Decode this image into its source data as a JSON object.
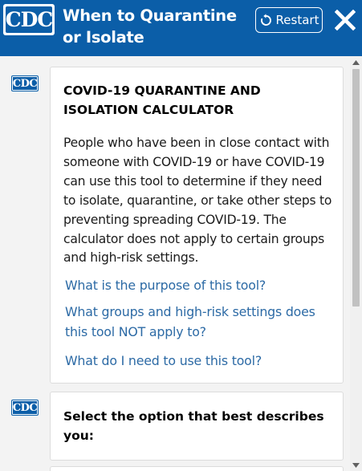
{
  "header": {
    "logo_text": "CDC",
    "title": "When to Quarantine or Isolate",
    "restart_label": "Restart",
    "brand_color": "#0b5ea8"
  },
  "messages": [
    {
      "avatar_text": "CDC",
      "heading": "COVID-19 QUARANTINE AND ISOLATION CALCULATOR",
      "body": "People who have been in close contact with someone with COVID-19 or have COVID-19 can use this tool to determine if they need to isolate, quarantine, or take other steps to preventing spreading COVID-19. The calculator does not apply to certain groups and high-risk settings.",
      "links": [
        "What is the purpose of this tool?",
        "What groups and high-risk settings does this tool NOT apply to?",
        "What do I need to use this tool?"
      ]
    },
    {
      "avatar_text": "CDC",
      "heading": "Select the option that best describes you:"
    }
  ],
  "colors": {
    "link": "#2c6aa5",
    "content_bg": "#f3f3f3"
  }
}
